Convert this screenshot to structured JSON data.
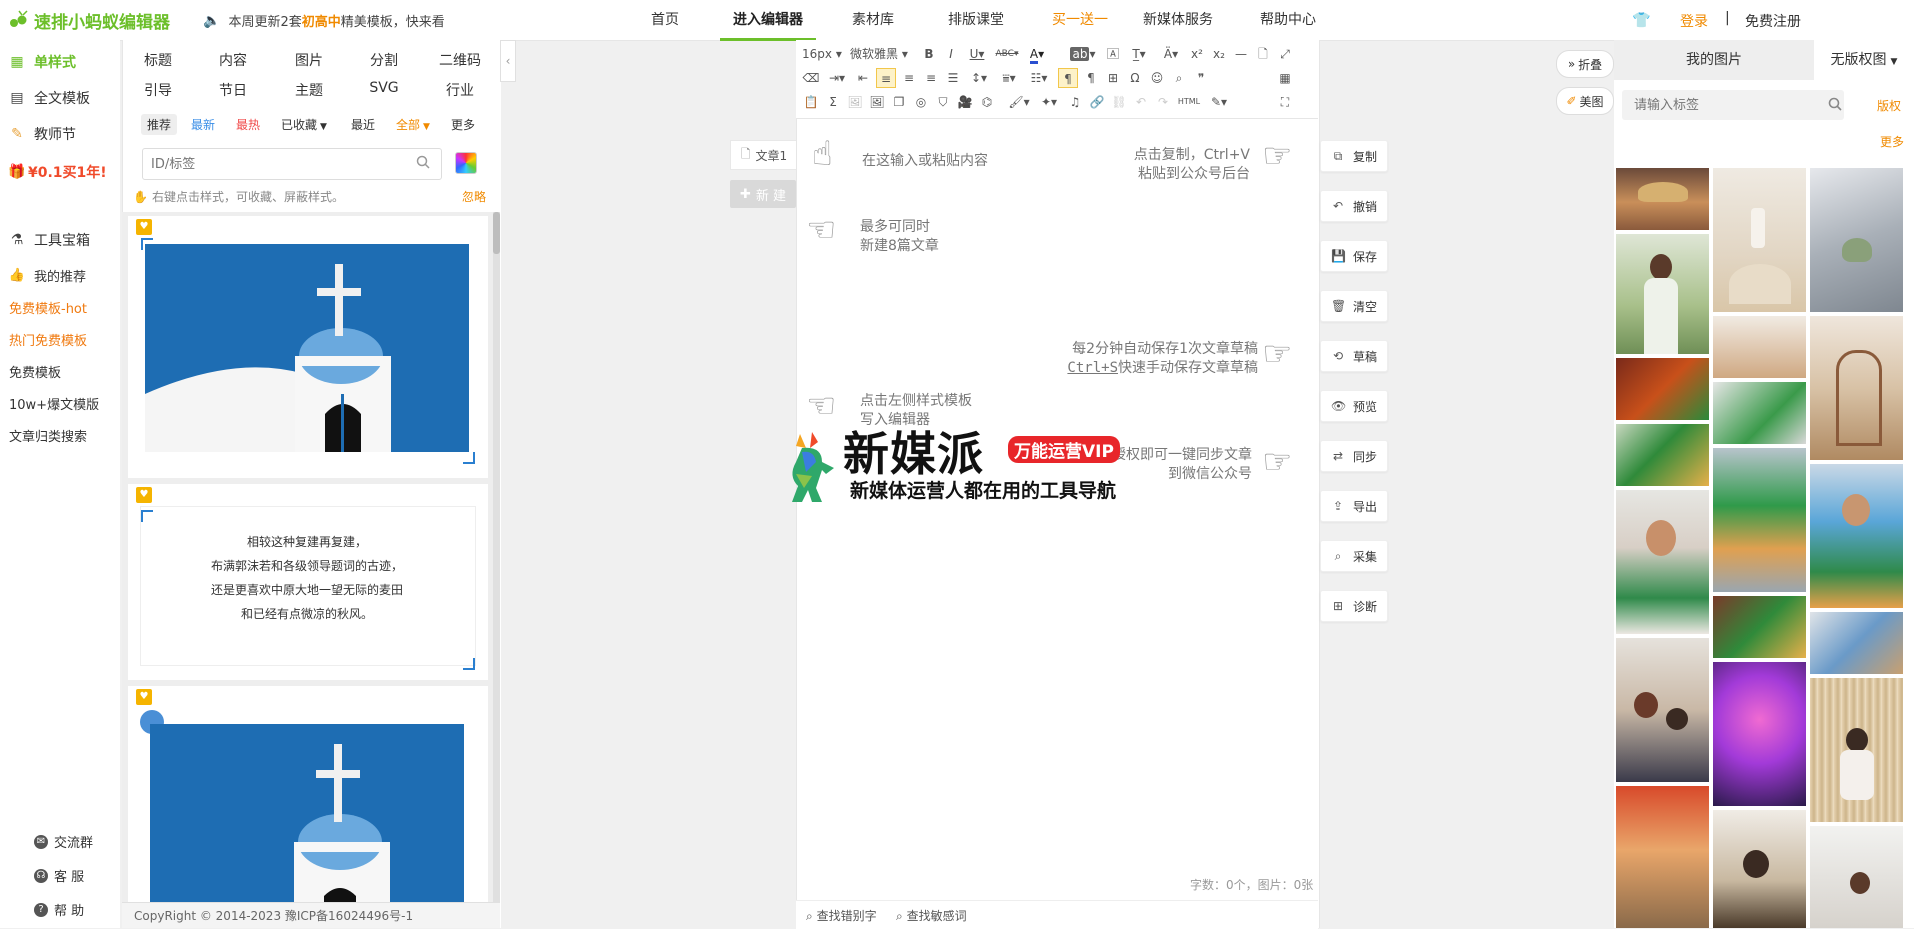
{
  "topbar": {
    "logo_text": "速排小蚂蚁编辑器",
    "notice_prefix": "本周更新2套",
    "notice_highlight": "初高中",
    "notice_suffix": "精美模板，快来看",
    "nav": [
      "首页",
      "进入编辑器",
      "素材库",
      "排版课堂",
      "买一送一",
      "新媒体服务",
      "帮助中心"
    ],
    "login": "登录",
    "separator": "|",
    "register": "免费注册"
  },
  "leftnav": {
    "single_style": "单样式",
    "full_template": "全文模板",
    "teacher_day": "教师节",
    "promo": "¥0.1买1年!",
    "toolbox": "工具宝箱",
    "sub_items": [
      "我的推荐",
      "免费模板-hot",
      "热门免费模板",
      "免费模板",
      "10w+爆文模版",
      "文章归类搜索"
    ],
    "bottom": [
      "交流群",
      "客 服",
      "帮 助"
    ]
  },
  "stylepanel": {
    "categories_row1": [
      "标题",
      "内容",
      "图片",
      "分割",
      "二维码"
    ],
    "categories_row2": [
      "引导",
      "节日",
      "主题",
      "SVG",
      "行业"
    ],
    "filters": [
      "推荐",
      "最新",
      "最热",
      "已收藏",
      "最近",
      "全部",
      "更多"
    ],
    "search_placeholder": "ID/标签",
    "tip": "右键点击样式，可收藏、屏蔽样式。",
    "ignore": "忽略",
    "poem": [
      "相较这种复建再复建，",
      "布满郭沫若和各级领导题词的古迹，",
      "还是更喜欢中原大地一望无际的麦田",
      "和已经有点微凉的秋风。"
    ],
    "copyright": "CopyRight © 2014-2023 豫ICP备16024496号-1"
  },
  "articles": {
    "tab": "文章1",
    "new": "新 建"
  },
  "editor": {
    "font_size": "16px",
    "font_family": "微软雅黑",
    "hint_paste": "在这输入或粘贴内容",
    "hint_copy_line1": "点击复制，Ctrl+V",
    "hint_copy_line2": "粘贴到公众号后台",
    "hint_max_line1": "最多可同时",
    "hint_max_line2": "新建8篇文章",
    "hint_autosave_line1": "每2分钟自动保存1次文章草稿",
    "hint_autosave_key": "Ctrl+S",
    "hint_autosave_line2": "快速手动保存文章草稿",
    "hint_left_line1": "点击左侧样式模板",
    "hint_left_line2": "写入编辑器",
    "hint_sync_line1": "授权即可一键同步文章",
    "hint_sync_line2": "到微信公众号",
    "word_count": "字数：0个，图片：0张",
    "footer_typo": "查找错别字",
    "footer_sensitive": "查找敏感词"
  },
  "watermark": {
    "title": "新媒派",
    "badge": "万能运营VIP",
    "subtitle": "新媒体运营人都在用的工具导航"
  },
  "actions": [
    "复制",
    "撤销",
    "保存",
    "清空",
    "草稿",
    "预览",
    "同步",
    "导出",
    "采集",
    "诊断"
  ],
  "imgpanel": {
    "fold": "折叠",
    "meitu": "美图",
    "tab_my": "我的图片",
    "tab_free": "无版权图",
    "tag_placeholder": "请输入标签",
    "copyright_link": "版权",
    "more": "更多"
  },
  "colors": {
    "brand_green": "#6cbf2a",
    "accent_orange": "#f08a00",
    "promo_red": "#f04a2a",
    "sky_blue": "#1e6db3"
  }
}
